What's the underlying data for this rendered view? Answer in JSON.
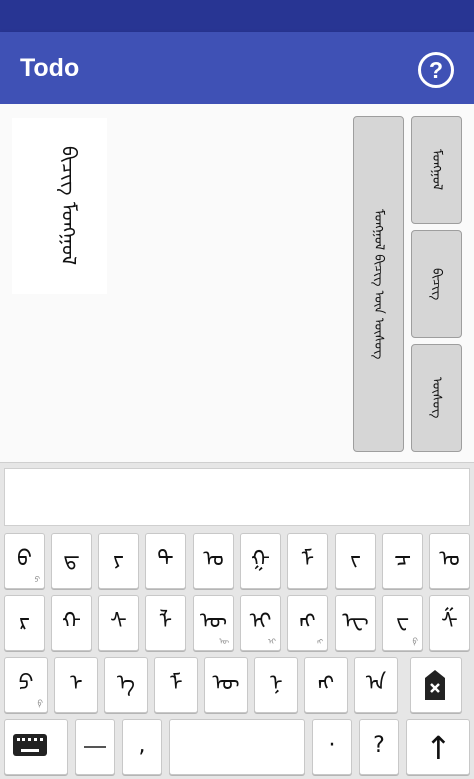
{
  "app": {
    "title": "Todo",
    "help_label": "?"
  },
  "note": {
    "text": "ᠪᠢᠴᠢᠭ᠌ ᠮᠣᠩᠭᠣᠯ"
  },
  "suggestions": {
    "main": "ᠮᠣᠩᠭᠣᠯ ᠪᠢᠴᠢᠭ ᠦᠨ ᠦᠰᠦᠭ",
    "items": [
      "ᠮᠣᠩᠭᠣᠯ",
      "ᠪᠢᠴᠢᠭ",
      "ᠦᠰᠦᠭ"
    ]
  },
  "input": {
    "value": ""
  },
  "keyboard": {
    "row1": [
      {
        "main": "ᠪ",
        "sub": "ᠫ"
      },
      {
        "main": "ᠳ",
        "sub": ""
      },
      {
        "main": "ᠶ",
        "sub": ""
      },
      {
        "main": "ᠲ",
        "sub": ""
      },
      {
        "main": "ᠣ",
        "sub": ""
      },
      {
        "main": "ᠭ",
        "sub": ""
      },
      {
        "main": "ᠮ",
        "sub": ""
      },
      {
        "main": "ᠵ",
        "sub": ""
      },
      {
        "main": "ᠴ",
        "sub": ""
      },
      {
        "main": "ᠤ",
        "sub": ""
      }
    ],
    "row2": [
      {
        "main": "ᠷ",
        "sub": ""
      },
      {
        "main": "ᠬ",
        "sub": ""
      },
      {
        "main": "ᠰ",
        "sub": ""
      },
      {
        "main": "ᠯ",
        "sub": ""
      },
      {
        "main": "ᠥ",
        "sub": "ᠦ"
      },
      {
        "main": "ᠢ",
        "sub": "ᠢ"
      },
      {
        "main": "ᠩ",
        "sub": "ᠩ"
      },
      {
        "main": "ᠧ",
        "sub": ""
      },
      {
        "main": "ᠸ",
        "sub": "ᠹ"
      },
      {
        "main": "ᠱ",
        "sub": ""
      }
    ],
    "row3": [
      {
        "main": "ᠫ",
        "sub": "ᠹ"
      },
      {
        "main": "ᠨ᠋",
        "sub": ""
      },
      {
        "main": "ᠡ",
        "sub": ""
      },
      {
        "main": "ᠮ",
        "sub": ""
      },
      {
        "main": "ᠦ",
        "sub": ""
      },
      {
        "main": "ᠨ",
        "sub": ""
      },
      {
        "main": "ᠩ",
        "sub": ""
      },
      {
        "main": "ᠠ",
        "sub": ""
      }
    ],
    "row4": {
      "comma": ",",
      "period": "·",
      "question": "?",
      "shift": "↑"
    }
  }
}
